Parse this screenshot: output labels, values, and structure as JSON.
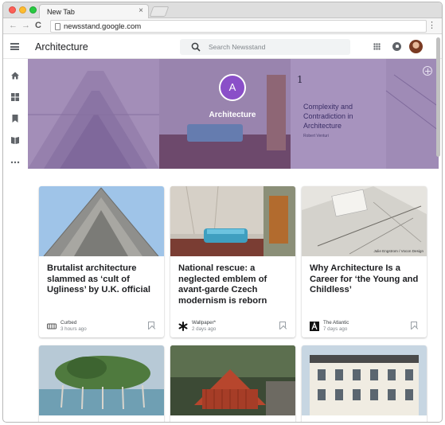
{
  "browser": {
    "tab_title": "New Tab",
    "tab_close": "×",
    "url": "newsstand.google.com",
    "back": "←",
    "forward": "→",
    "reload": "C",
    "menu": "⋮"
  },
  "app": {
    "title": "Architecture",
    "search_placeholder": "Search Newsstand",
    "accent_color": "#8a4fc8"
  },
  "sidebar": {
    "items": [
      {
        "name": "home-icon",
        "glyph": "⌂"
      },
      {
        "name": "grid-icon",
        "glyph": "▦"
      },
      {
        "name": "bookmark-icon",
        "glyph": "▮"
      },
      {
        "name": "library-icon",
        "glyph": "▤"
      },
      {
        "name": "more-icon",
        "glyph": "⋯"
      }
    ]
  },
  "hero": {
    "badge_letter": "A",
    "title": "Architecture",
    "book_number": "1",
    "book_title": "Complexity and Contradiction in Architecture",
    "book_author": "Robert Venturi"
  },
  "cards": [
    {
      "headline": "Brutalist architecture slammed as ‘cult of Ugliness’ by U.K. official",
      "publisher": "Curbed",
      "time": "3 hours ago",
      "icon": "curbed-logo-icon"
    },
    {
      "headline": "National rescue: a neglected emblem of avant-garde Czech modernism is reborn",
      "publisher": "Wallpaper*",
      "time": "2 days ago",
      "icon": "wallpaper-logo-icon"
    },
    {
      "headline": "Why Architecture Is a Career for ‘the Young and Childless’",
      "publisher": "The Atlantic",
      "time": "7 days ago",
      "icon": "atlantic-logo-icon",
      "image_credit": "Julie Engstrom / Vocon Design"
    }
  ]
}
